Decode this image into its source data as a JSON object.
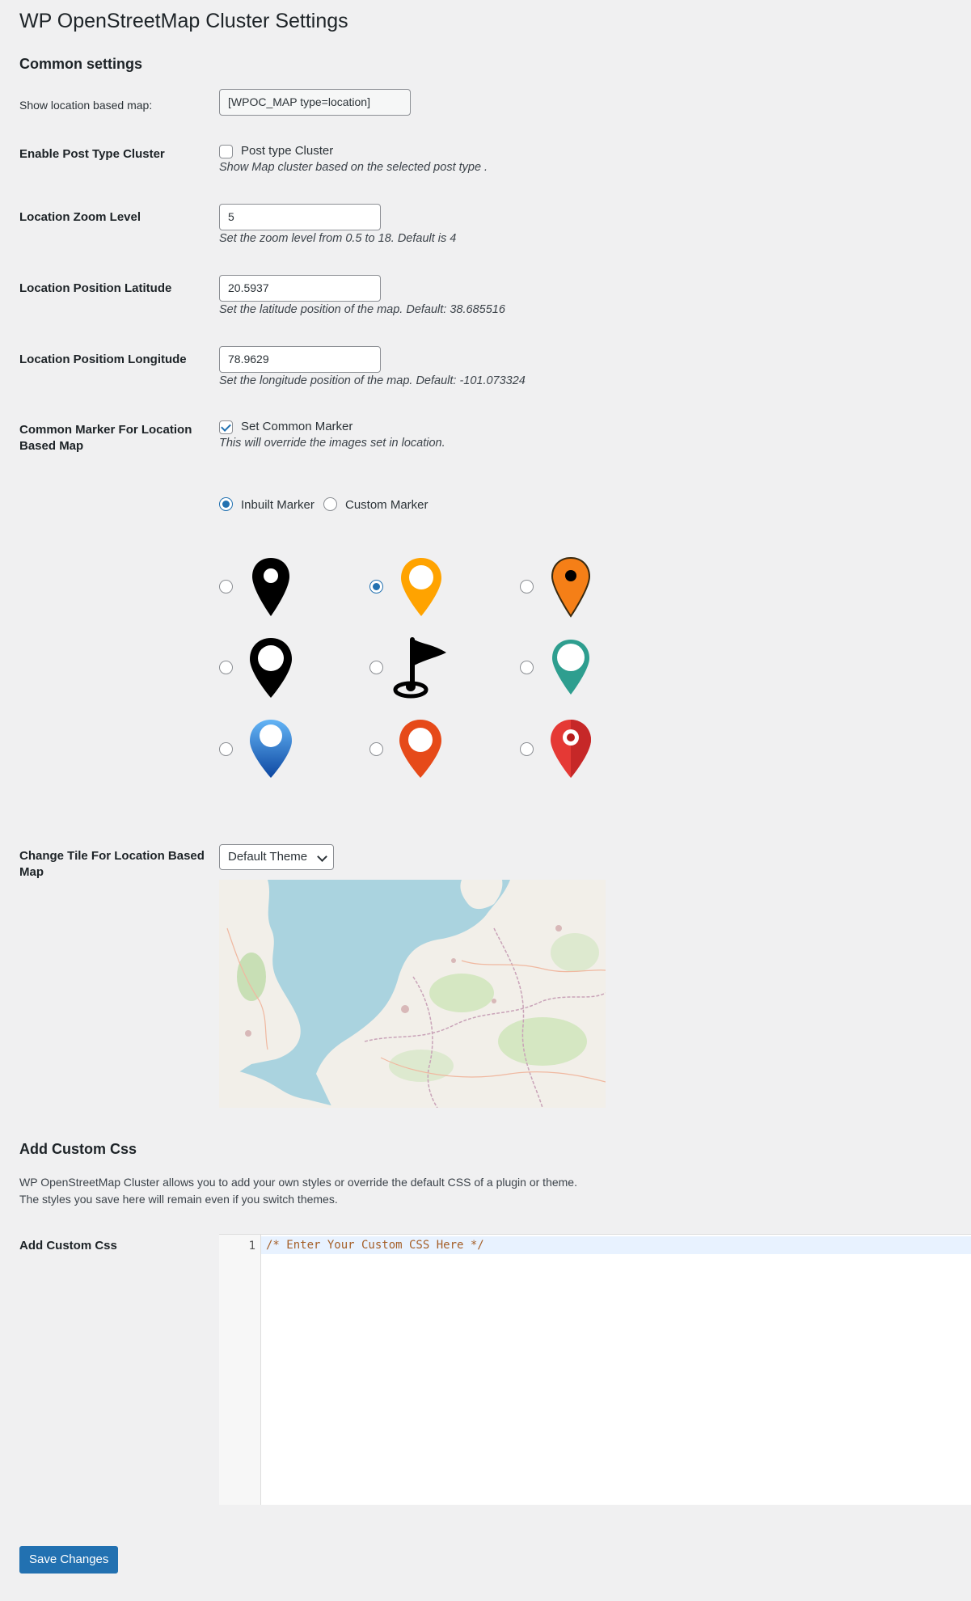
{
  "page": {
    "title": "WP OpenStreetMap Cluster Settings"
  },
  "common": {
    "heading": "Common settings",
    "shortcode_label": "Show location based map:",
    "shortcode_value": "[WPOC_MAP type=location]",
    "post_type_label": "Enable Post Type Cluster",
    "post_type_checkbox": "Post type Cluster",
    "post_type_desc": "Show Map cluster based on the selected post type .",
    "zoom_label": "Location Zoom Level",
    "zoom_value": "5",
    "zoom_desc": "Set the zoom level from 0.5 to 18. Default is 4",
    "lat_label": "Location Position Latitude",
    "lat_value": "20.5937",
    "lat_desc": "Set the latitude position of the map. Default: 38.685516",
    "lng_label": "Location Positiom Longitude",
    "lng_value": "78.9629",
    "lng_desc": "Set the longitude position of the map. Default: -101.073324",
    "marker_label": "Common Marker For Location Based Map",
    "marker_checkbox": "Set Common Marker",
    "marker_desc": "This will override the images set in location.",
    "marker_type_options": [
      "Inbuilt Marker",
      "Custom Marker"
    ],
    "marker_type_selected": "Inbuilt Marker",
    "markers": [
      {
        "icon": "black-pin-icon",
        "color": "#000000"
      },
      {
        "icon": "orange-ring-pin-icon",
        "color": "#ffa300"
      },
      {
        "icon": "orange-dot-pin-icon",
        "color": "#f57f17"
      },
      {
        "icon": "black-ring-pin-icon",
        "color": "#000000"
      },
      {
        "icon": "golf-flag-icon",
        "color": "#000000"
      },
      {
        "icon": "teal-ring-pin-icon",
        "color": "#2e9e8f"
      },
      {
        "icon": "blue-pin-icon",
        "color": "#1e88e5"
      },
      {
        "icon": "red-orange-pin-icon",
        "color": "#e64a19"
      },
      {
        "icon": "red-pin-icon",
        "color": "#e53935"
      }
    ],
    "marker_selected_index": 1,
    "tile_label": "Change Tile For Location Based Map",
    "tile_value": "Default Theme"
  },
  "css": {
    "heading": "Add Custom Css",
    "intro_line1": "WP OpenStreetMap Cluster allows you to add your own styles or override the default CSS of a plugin or theme.",
    "intro_line2": "The styles you save here will remain even if you switch themes.",
    "label": "Add Custom Css",
    "line_number": "1",
    "code": "/* Enter Your Custom CSS Here */"
  },
  "actions": {
    "save": "Save Changes"
  },
  "colors": {
    "accent": "#2271b1",
    "background": "#f0f0f1",
    "text": "#1d2327"
  }
}
